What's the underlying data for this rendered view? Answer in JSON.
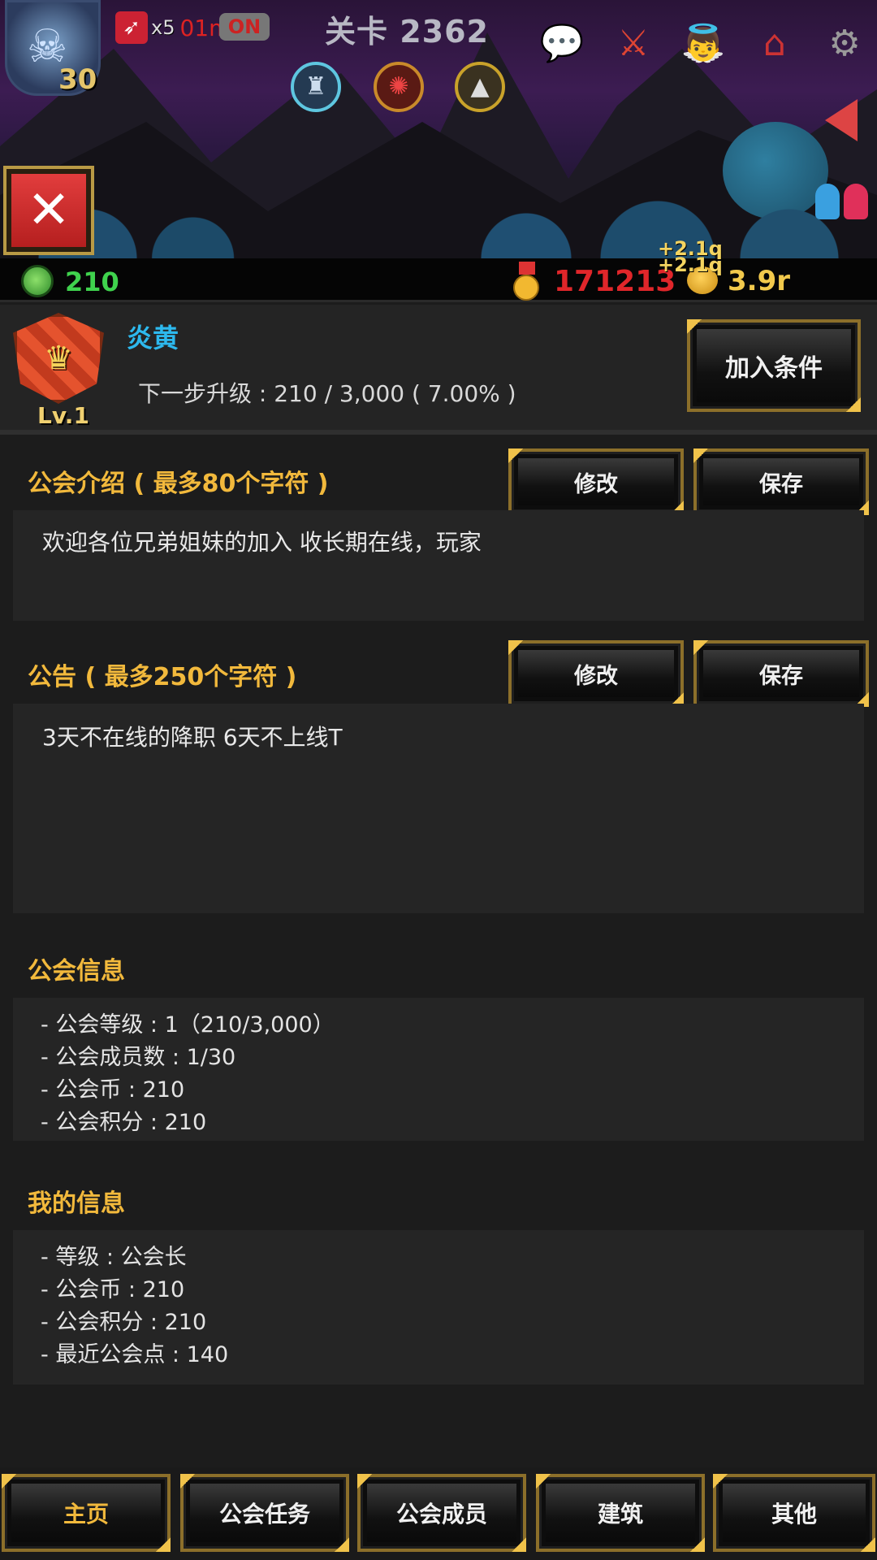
{
  "hud": {
    "hero_level": "30",
    "boost_multiplier": "x5",
    "boost_timer": "01m",
    "auto_toggle": "ON",
    "stage_title": "关卡 2362"
  },
  "icons": {
    "hero": "skull-knight-icon",
    "boost": "winged-boot-icon",
    "chat": "chat-bubble-icon",
    "guild": "guild-banner-icon",
    "angel": "angel-icon",
    "shop": "shop-house-icon",
    "settings": "gear-icon",
    "skills": [
      "skill-cake-icon",
      "skill-vortex-icon",
      "skill-horn-icon"
    ],
    "expand": "triangle-left-icon",
    "close": "close-icon",
    "guild_coin": "guild-coin-icon",
    "medal": "medal-icon",
    "gold": "gold-coin-icon",
    "emblem": "guild-emblem-icon"
  },
  "currency": {
    "guild_coin": "210",
    "medal": "171213",
    "gold": "3.9r",
    "gain_popup_1": "+2.1q",
    "gain_popup_2": "+2.1q"
  },
  "guild": {
    "name": "炎黄",
    "level_label": "Lv.1",
    "progress_text": "下一步升级 : 210 / 3,000 ( 7.00% )",
    "progress_fraction": 0.07,
    "join_condition_button": "加入条件"
  },
  "intro": {
    "title": "公会介绍 ( 最多80个字符 )",
    "edit_button": "修改",
    "save_button": "保存",
    "text": "欢迎各位兄弟姐妹的加入  收长期在线，玩家"
  },
  "notice": {
    "title": "公告 ( 最多250个字符 )",
    "edit_button": "修改",
    "save_button": "保存",
    "text": "3天不在线的降职  6天不上线T"
  },
  "guild_info": {
    "title": "公会信息",
    "lines": [
      "- 公会等级 : 1（210/3,000）",
      "- 公会成员数 : 1/30",
      "- 公会币 : 210",
      "- 公会积分 : 210"
    ]
  },
  "my_info": {
    "title": "我的信息",
    "lines": [
      "- 等级 : 公会长",
      "- 公会币 : 210",
      "- 公会积分 : 210",
      "- 最近公会点 : 140"
    ]
  },
  "nav": {
    "items": [
      {
        "label": "主页",
        "active": true
      },
      {
        "label": "公会任务",
        "active": false
      },
      {
        "label": "公会成员",
        "active": false
      },
      {
        "label": "建筑",
        "active": false
      },
      {
        "label": "其他",
        "active": false
      }
    ]
  },
  "colors": {
    "accent_gold": "#f2b93c",
    "guild_name_blue": "#2db9ee",
    "medal_red": "#e0262a",
    "coin_green": "#3fd24d",
    "close_red": "#d32f2f"
  }
}
